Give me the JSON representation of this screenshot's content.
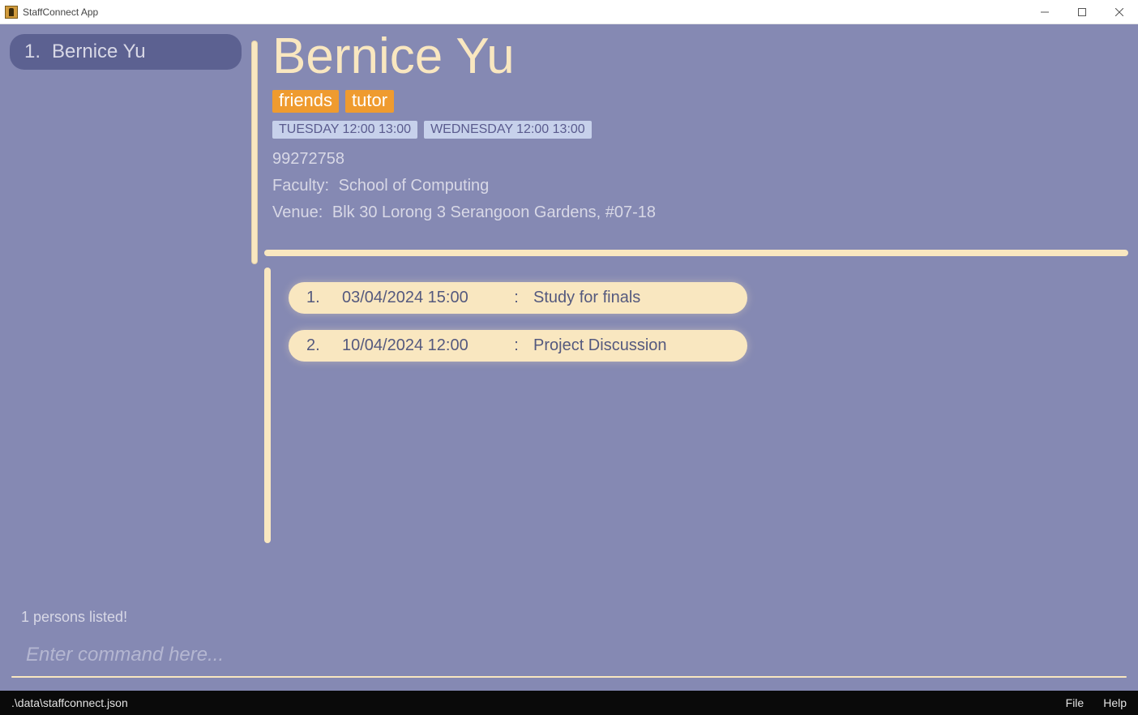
{
  "window": {
    "title": "StaffConnect App"
  },
  "sidebar": {
    "items": [
      {
        "index": "1.",
        "name": "Bernice Yu"
      }
    ]
  },
  "detail": {
    "name": "Bernice Yu",
    "tags": [
      "friends",
      "tutor"
    ],
    "availabilities": [
      "TUESDAY 12:00 13:00",
      "WEDNESDAY 12:00 13:00"
    ],
    "phone": "99272758",
    "faculty_label": "Faculty:",
    "faculty_value": "School of Computing",
    "venue_label": "Venue:",
    "venue_value": "Blk 30 Lorong 3 Serangoon Gardens, #07-18",
    "meetings": [
      {
        "index": "1.",
        "when": "03/04/2024 15:00",
        "sep": ":",
        "desc": "Study for finals"
      },
      {
        "index": "2.",
        "when": "10/04/2024 12:00",
        "sep": ":",
        "desc": "Project Discussion"
      }
    ]
  },
  "result": {
    "text": "1 persons listed!"
  },
  "command": {
    "placeholder": "Enter command here...",
    "value": ""
  },
  "footer": {
    "path": ".\\data\\staffconnect.json",
    "menu": {
      "file": "File",
      "help": "Help"
    }
  }
}
